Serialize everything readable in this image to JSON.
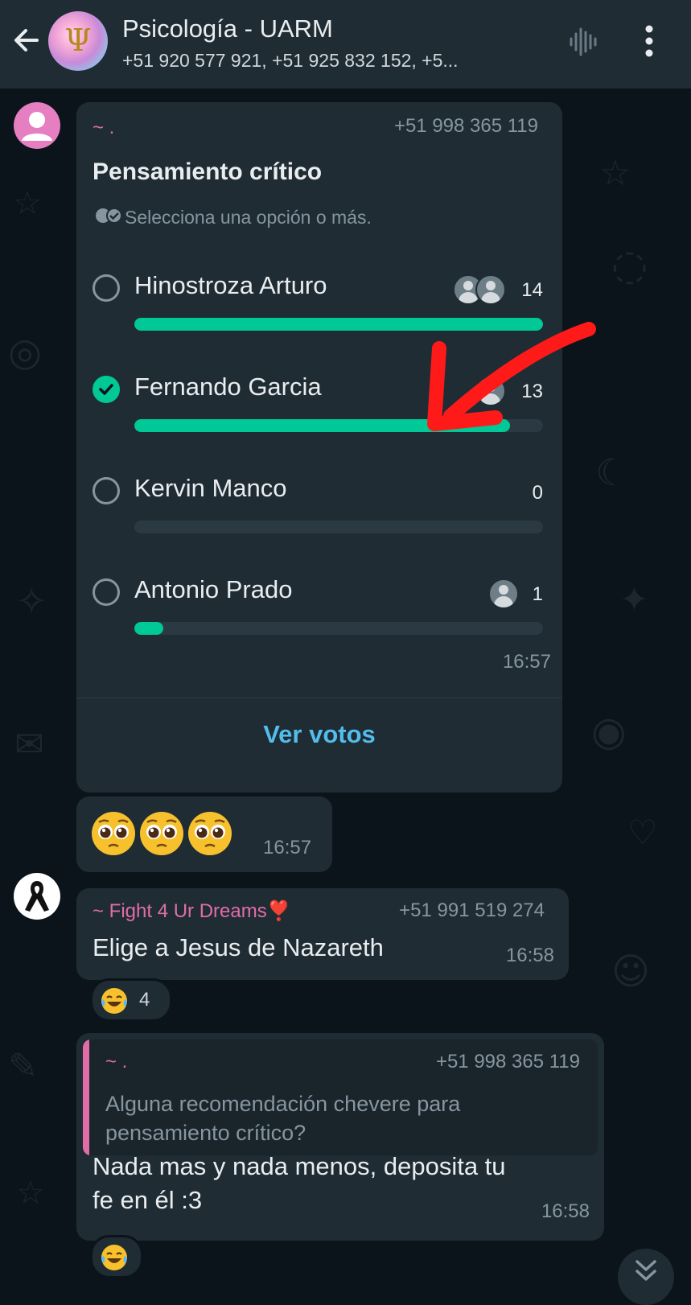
{
  "header": {
    "title": "Psicología - UARM",
    "subtitle": "+51 920 577 921, +51 925 832 152, +5..."
  },
  "poll": {
    "sender_name": "~ .",
    "sender_phone": "+51 998 365 119",
    "title": "Pensamiento crítico",
    "hint": "Selecciona una opción o más.",
    "options": [
      {
        "label": "Hinostroza Arturo",
        "votes": "14",
        "share": 1.0,
        "selected": false
      },
      {
        "label": "Fernando Garcia",
        "votes": "13",
        "share": 0.92,
        "selected": true
      },
      {
        "label": "Kervin Manco",
        "votes": "0",
        "share": 0.0,
        "selected": false
      },
      {
        "label": "Antonio Prado",
        "votes": "1",
        "share": 0.07,
        "selected": false
      }
    ],
    "time": "16:57",
    "view_votes_label": "Ver votos"
  },
  "emoji_message": {
    "emoji": "pleading-face x3",
    "time": "16:57"
  },
  "message_1": {
    "sender_name": "~ Fight 4 Ur Dreams",
    "sender_emoji": "❣️",
    "sender_phone": "+51 991 519 274",
    "text": "Elige a Jesus de Nazareth",
    "time": "16:58",
    "reaction_emoji": "face-with-tears-of-joy",
    "reaction_count": "4"
  },
  "message_2": {
    "quote_sender": "~ .",
    "quote_phone": "+51 998 365 119",
    "quote_text": "Alguna recomendación chevere para pensamiento crítico?",
    "text_line1": "Nada mas y nada menos, deposita tu",
    "text_line2": "fe en él :3",
    "time": "16:58",
    "reaction_emoji": "face-with-tears-of-joy"
  },
  "colors": {
    "background": "#0b141a",
    "bubble": "#1f2c34",
    "accent_green": "#00c896",
    "link_blue": "#53bdeb",
    "sender_pink": "#e06da8",
    "annotation_arrow": "#ff1a1a"
  }
}
